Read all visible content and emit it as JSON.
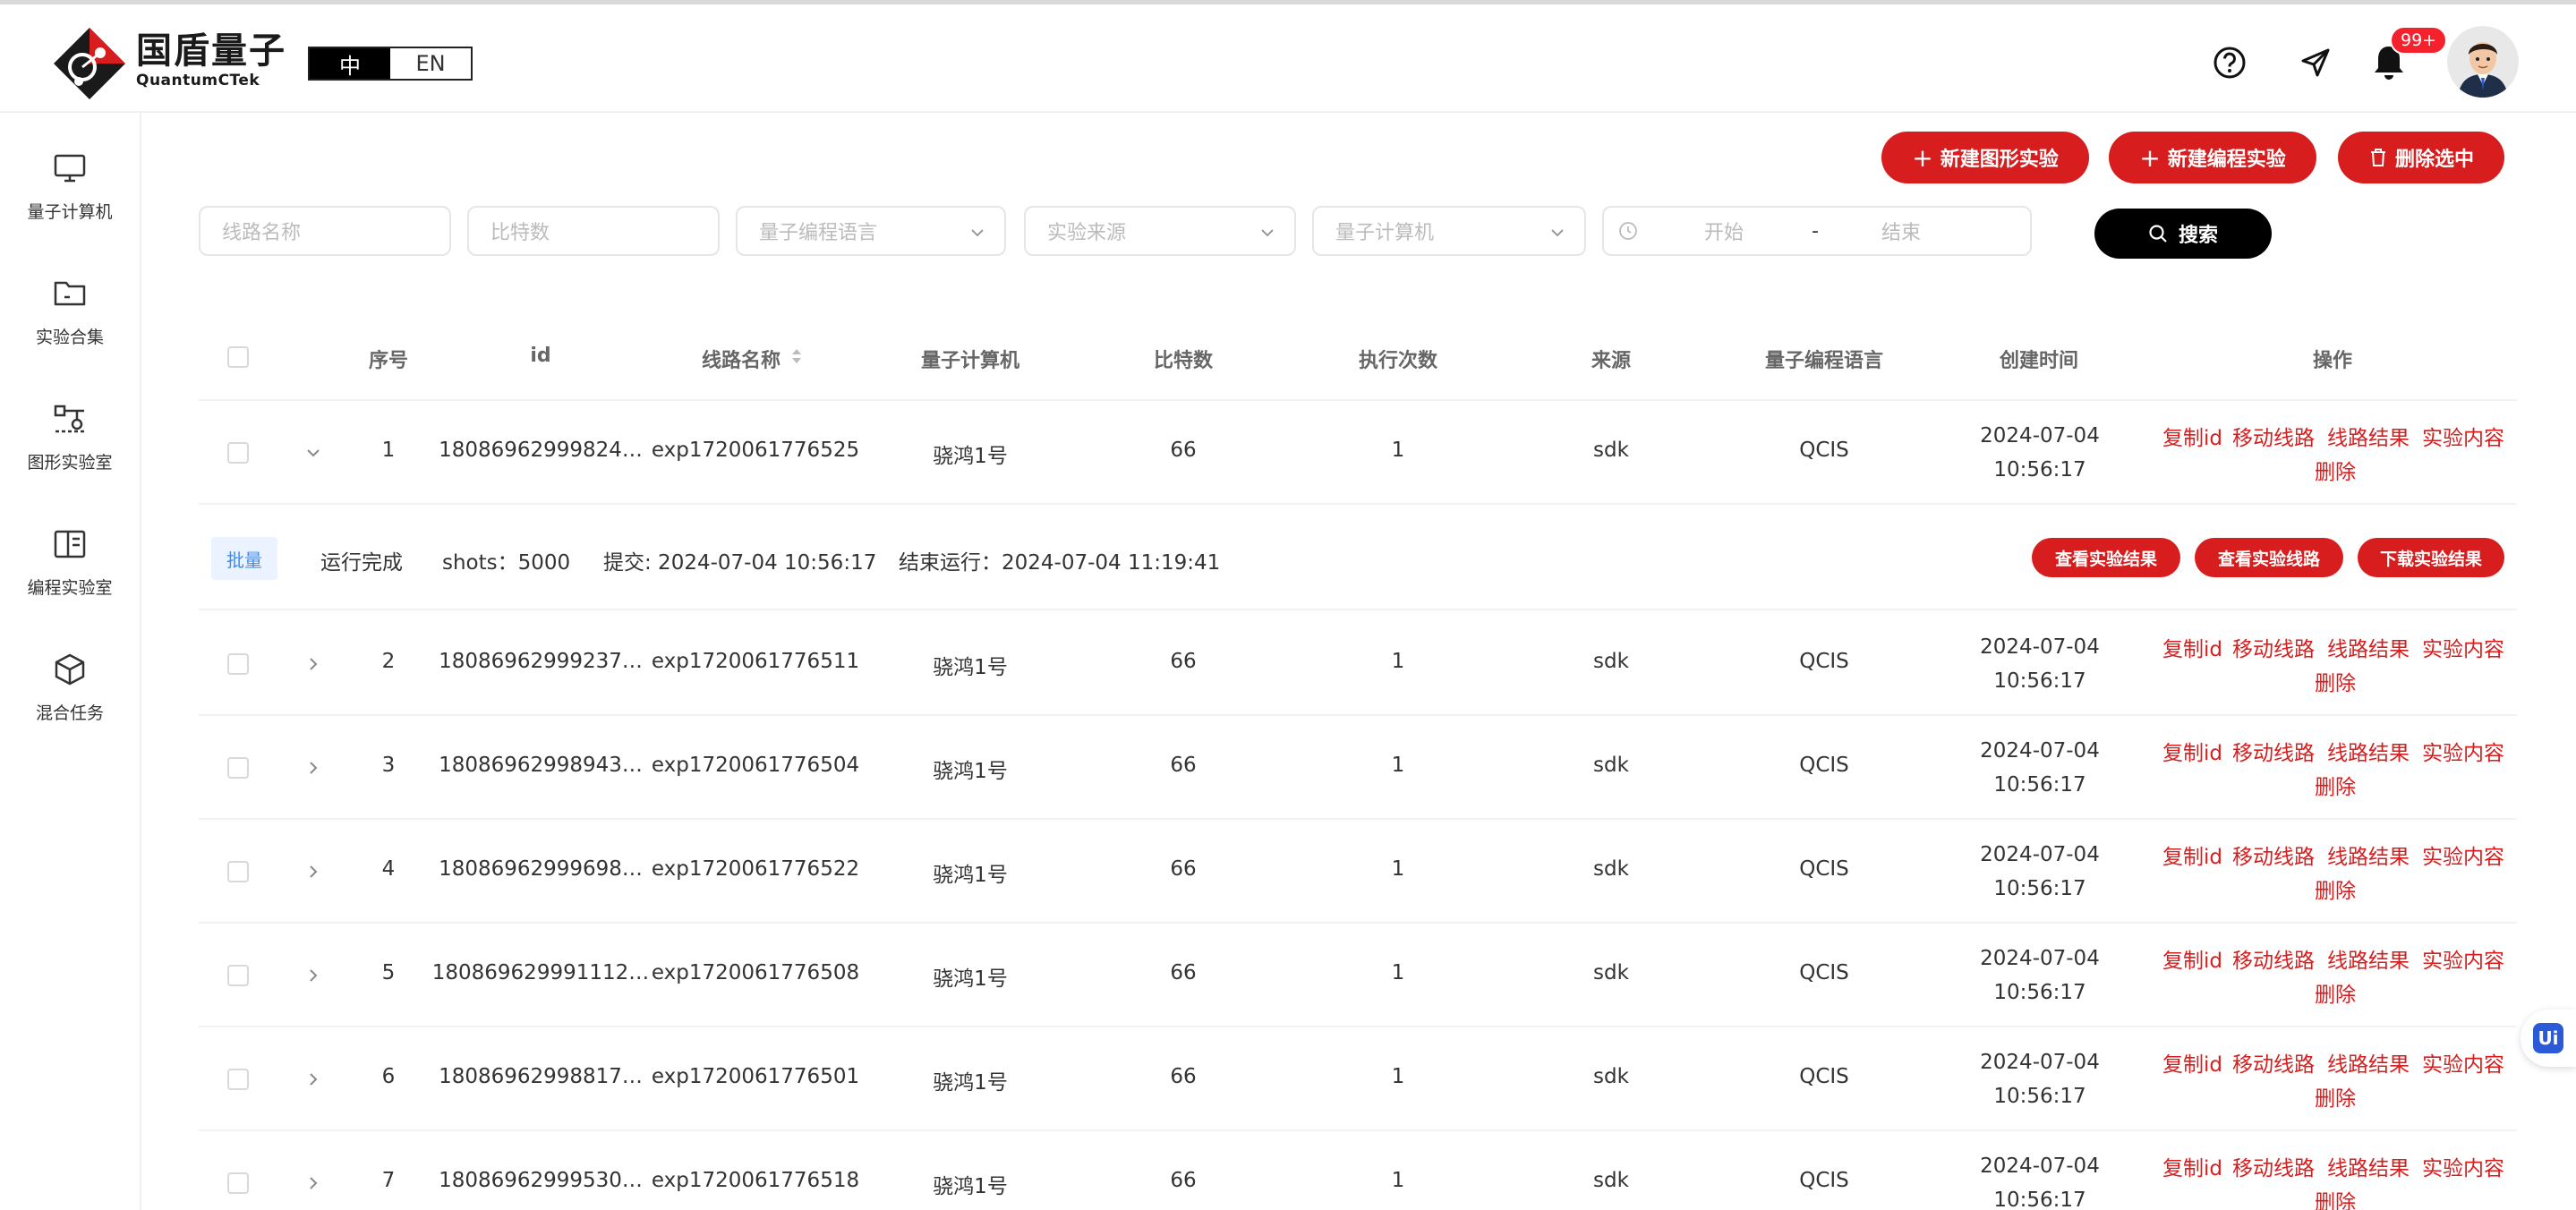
{
  "header": {
    "logo_cn": "国盾量子",
    "logo_en": "QuantumCTek",
    "lang_zh": "中",
    "lang_en": "EN",
    "notify_badge": "99+"
  },
  "sidebar": {
    "items": [
      {
        "label": "量子计算机",
        "icon": "monitor-icon"
      },
      {
        "label": "实验合集",
        "icon": "folder-icon"
      },
      {
        "label": "图形实验室",
        "icon": "circuit-icon"
      },
      {
        "label": "编程实验室",
        "icon": "book-icon"
      },
      {
        "label": "混合任务",
        "icon": "cube-icon"
      }
    ]
  },
  "toolbar": {
    "new_graphic": "新建图形实验",
    "new_program": "新建编程实验",
    "delete_selected": "删除选中"
  },
  "filters": {
    "circuit_name": "线路名称",
    "qubits": "比特数",
    "language": "量子编程语言",
    "source": "实验来源",
    "computer": "量子计算机",
    "start": "开始",
    "dash": "-",
    "end": "结束",
    "search": "搜索"
  },
  "table": {
    "headers": {
      "index": "序号",
      "id": "id",
      "name": "线路名称",
      "computer": "量子计算机",
      "qubits": "比特数",
      "runs": "执行次数",
      "source": "来源",
      "lang": "量子编程语言",
      "created": "创建时间",
      "ops": "操作"
    },
    "actions": {
      "copy_id": "复制id",
      "move": "移动线路",
      "result": "线路结果",
      "content": "实验内容",
      "delete": "删除"
    },
    "rows": [
      {
        "index": "1",
        "id": "18086962999824…",
        "name": "exp1720061776525",
        "computer": "骁鸿1号",
        "qubits": "66",
        "runs": "1",
        "source": "sdk",
        "lang": "QCIS",
        "created": "2024-07-04 10:56:17"
      },
      {
        "index": "2",
        "id": "18086962999237…",
        "name": "exp1720061776511",
        "computer": "骁鸿1号",
        "qubits": "66",
        "runs": "1",
        "source": "sdk",
        "lang": "QCIS",
        "created": "2024-07-04 10:56:17"
      },
      {
        "index": "3",
        "id": "18086962998943…",
        "name": "exp1720061776504",
        "computer": "骁鸿1号",
        "qubits": "66",
        "runs": "1",
        "source": "sdk",
        "lang": "QCIS",
        "created": "2024-07-04 10:56:17"
      },
      {
        "index": "4",
        "id": "18086962999698…",
        "name": "exp1720061776522",
        "computer": "骁鸿1号",
        "qubits": "66",
        "runs": "1",
        "source": "sdk",
        "lang": "QCIS",
        "created": "2024-07-04 10:56:17"
      },
      {
        "index": "5",
        "id": "180869629991112…",
        "name": "exp1720061776508",
        "computer": "骁鸿1号",
        "qubits": "66",
        "runs": "1",
        "source": "sdk",
        "lang": "QCIS",
        "created": "2024-07-04 10:56:17"
      },
      {
        "index": "6",
        "id": "18086962998817…",
        "name": "exp1720061776501",
        "computer": "骁鸿1号",
        "qubits": "66",
        "runs": "1",
        "source": "sdk",
        "lang": "QCIS",
        "created": "2024-07-04 10:56:17"
      },
      {
        "index": "7",
        "id": "18086962999530…",
        "name": "exp1720061776518",
        "computer": "骁鸿1号",
        "qubits": "66",
        "runs": "1",
        "source": "sdk",
        "lang": "QCIS",
        "created": "2024-07-04 10:56:17"
      }
    ]
  },
  "expanded": {
    "tag": "批量",
    "status": "运行完成",
    "shots": "shots：5000",
    "submitted": "提交: 2024-07-04 10:56:17",
    "finished": "结束运行：2024-07-04 11:19:41",
    "btn_view_result": "查看实验结果",
    "btn_view_circuit": "查看实验线路",
    "btn_download": "下载实验结果"
  },
  "float_button": "Ui",
  "colors": {
    "accent": "#d71d1d",
    "tag_blue": "#3d8bf2"
  }
}
